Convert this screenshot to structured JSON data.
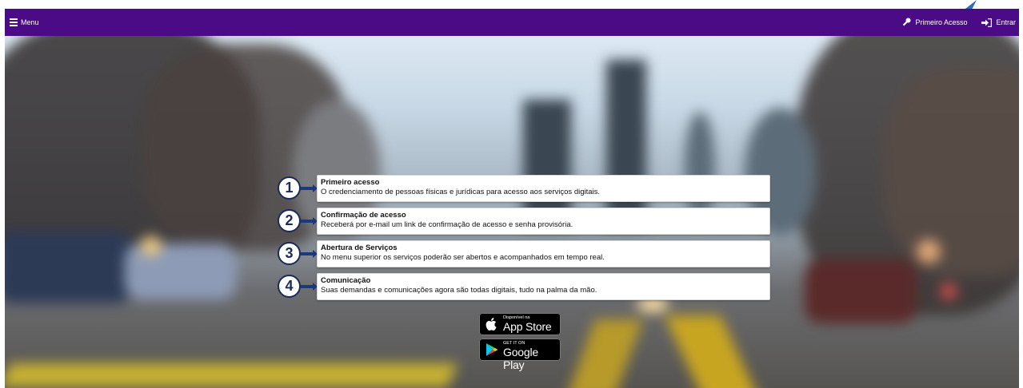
{
  "header": {
    "menu_label": "Menu",
    "first_access_label": "Primeiro Acesso",
    "login_label": "Entrar",
    "bar_color": "#4b0a86"
  },
  "steps": [
    {
      "number": "1",
      "title": "Primeiro acesso",
      "description": "O credenciamento de pessoas físicas e jurídicas para acesso aos serviços digitais."
    },
    {
      "number": "2",
      "title": "Confirmação de acesso",
      "description": "Receberá por e-mail um link de confirmação de acesso e senha provisória."
    },
    {
      "number": "3",
      "title": "Abertura de Serviços",
      "description": "No menu superior os serviços poderão ser abertos e acompanhados em tempo real."
    },
    {
      "number": "4",
      "title": "Comunicação",
      "description": "Suas demandas e comunicações agora são todas digitais, tudo na palma da mão."
    }
  ],
  "stores": {
    "appstore_small": "Disponível na",
    "appstore_big": "App Store",
    "googleplay_small": "GET IT ON",
    "googleplay_big": "Google Play"
  },
  "icons": {
    "menu": "hamburger-icon",
    "first_access": "key-icon",
    "login": "sign-in-icon",
    "apple": "apple-icon",
    "play": "google-play-icon"
  }
}
